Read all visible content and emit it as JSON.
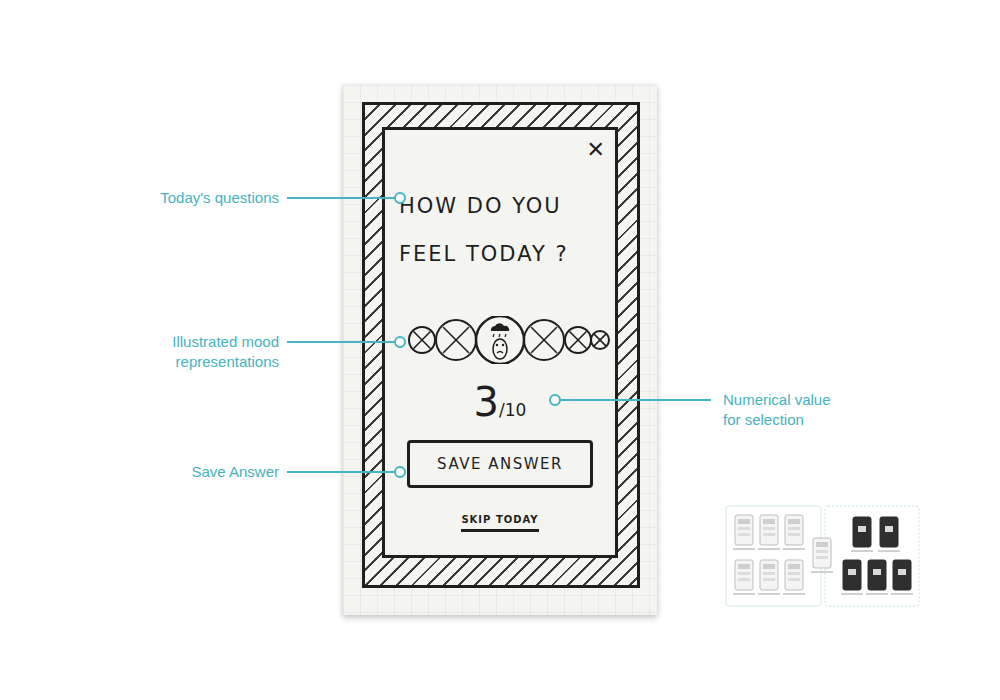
{
  "annotations": [
    {
      "label": "Today's questions",
      "side": "left"
    },
    {
      "label": "Illustrated mood representations",
      "side": "left"
    },
    {
      "label": "Save Answer",
      "side": "left"
    },
    {
      "label": "Numerical value for selection",
      "side": "right"
    }
  ],
  "sketch": {
    "close": "✕",
    "question": [
      "HOW DO YOU",
      "FEEL TODAY ?"
    ],
    "moods": [
      {
        "selected": false
      },
      {
        "selected": false
      },
      {
        "selected": true
      },
      {
        "selected": false
      },
      {
        "selected": false
      },
      {
        "selected": false
      }
    ],
    "rating": {
      "value": "3",
      "scale": "/10"
    },
    "save_button": "SAVE ANSWER",
    "skip_link": "SKIP TODAY"
  }
}
